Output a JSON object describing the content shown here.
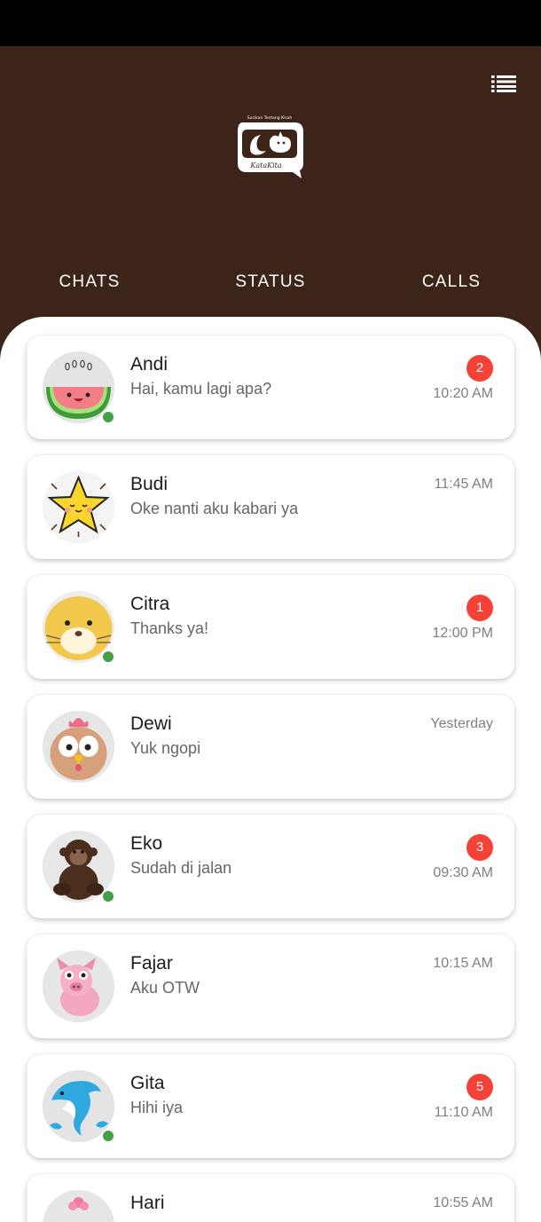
{
  "header": {
    "logo_tagline": "Sucikan Tentang Kisah",
    "logo_text": "KataKita",
    "tabs": [
      "CHATS",
      "STATUS",
      "CALLS"
    ]
  },
  "colors": {
    "header_bg": "#3c2419",
    "badge": "#f44336",
    "online": "#43a047"
  },
  "chats": [
    {
      "name": "Andi",
      "message": "Hai, kamu lagi apa?",
      "time": "10:20 AM",
      "unread": "2",
      "online": true,
      "avatar": "watermelon-avatar-icon"
    },
    {
      "name": "Budi",
      "message": "Oke nanti aku kabari ya",
      "time": "11:45 AM",
      "unread": "",
      "online": false,
      "avatar": "star-avatar-icon"
    },
    {
      "name": "Citra",
      "message": "Thanks ya!",
      "time": "12:00 PM",
      "unread": "1",
      "online": true,
      "avatar": "cat-avatar-icon"
    },
    {
      "name": "Dewi",
      "message": "Yuk ngopi",
      "time": "Yesterday",
      "unread": "",
      "online": false,
      "avatar": "owl-avatar-icon"
    },
    {
      "name": "Eko",
      "message": "Sudah di jalan",
      "time": "09:30 AM",
      "unread": "3",
      "online": true,
      "avatar": "monkey-avatar-icon"
    },
    {
      "name": "Fajar",
      "message": "Aku OTW",
      "time": "10:15 AM",
      "unread": "",
      "online": false,
      "avatar": "pig-avatar-icon"
    },
    {
      "name": "Gita",
      "message": "Hihi iya",
      "time": "11:10 AM",
      "unread": "5",
      "online": true,
      "avatar": "dolphin-avatar-icon"
    },
    {
      "name": "Hari",
      "message": "",
      "time": "10:55 AM",
      "unread": "",
      "online": false,
      "avatar": "flower-avatar-icon"
    }
  ]
}
